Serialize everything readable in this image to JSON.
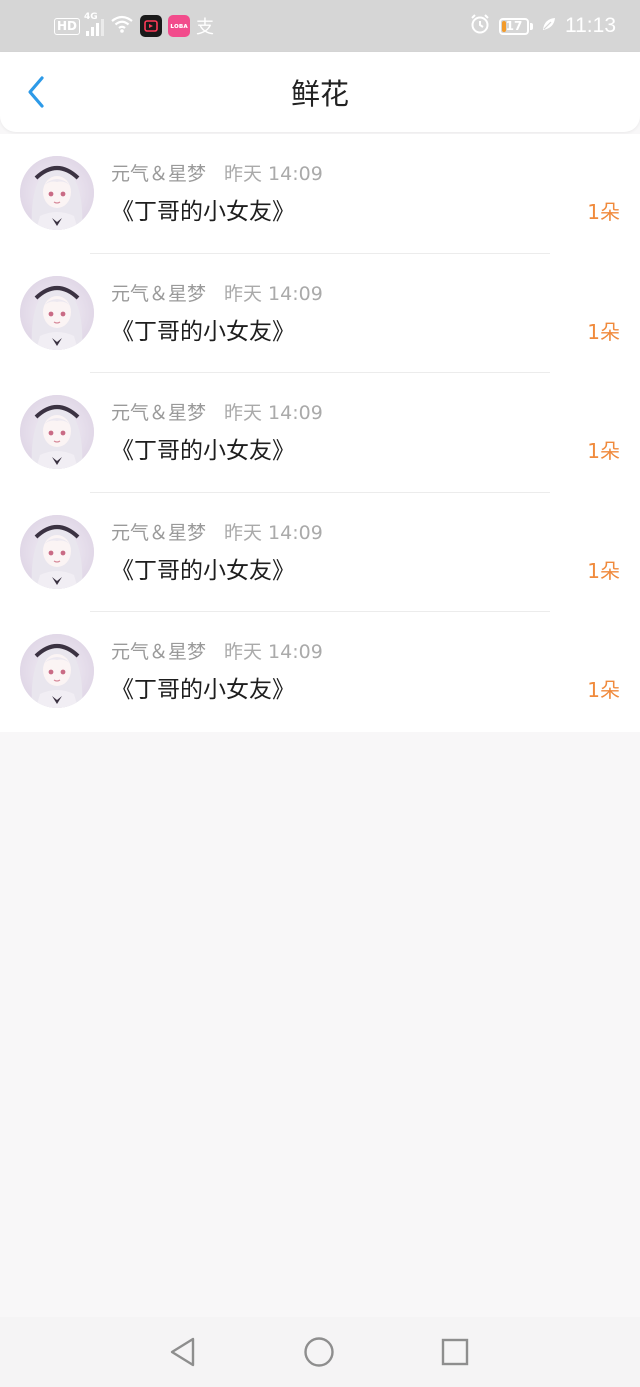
{
  "status_bar": {
    "hd": "HD",
    "network": "4G",
    "battery_level": "17",
    "time": "11:13",
    "app_icons": [
      {
        "name": "douyin-app-icon",
        "color": "#1a1a1a"
      },
      {
        "name": "pink-app-icon",
        "color": "#f24c8c",
        "text": "ʟᴏʙᴀ"
      },
      {
        "name": "alipay-icon",
        "color": "transparent",
        "text": "支"
      }
    ]
  },
  "header": {
    "back_icon": "chevron-left-icon",
    "title": "鲜花"
  },
  "colors": {
    "accent_blue": "#2d9ae8",
    "count_orange": "#f08a3c"
  },
  "items": [
    {
      "user": "元气＆星梦",
      "time": "昨天 14:09",
      "book": "《丁哥的小女友》",
      "count": "1朵"
    },
    {
      "user": "元气＆星梦",
      "time": "昨天 14:09",
      "book": "《丁哥的小女友》",
      "count": "1朵"
    },
    {
      "user": "元气＆星梦",
      "time": "昨天 14:09",
      "book": "《丁哥的小女友》",
      "count": "1朵"
    },
    {
      "user": "元气＆星梦",
      "time": "昨天 14:09",
      "book": "《丁哥的小女友》",
      "count": "1朵"
    },
    {
      "user": "元气＆星梦",
      "time": "昨天 14:09",
      "book": "《丁哥的小女友》",
      "count": "1朵"
    }
  ],
  "nav": {
    "back": "triangle-back-icon",
    "home": "circle-home-icon",
    "recents": "square-recents-icon"
  }
}
